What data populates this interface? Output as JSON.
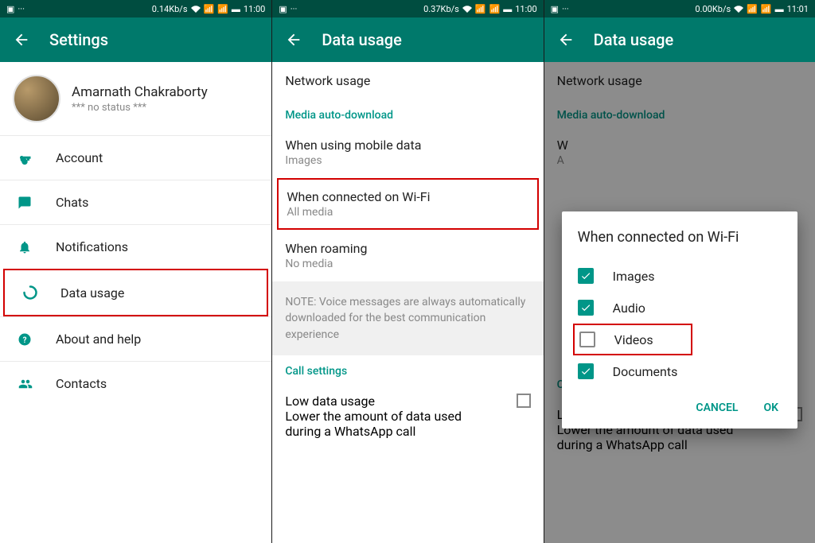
{
  "screen1": {
    "status": {
      "speed": "0.14Kb/s",
      "time": "11:00"
    },
    "title": "Settings",
    "profile": {
      "name": "Amarnath Chakraborty",
      "status": "*** no status ***"
    },
    "items": {
      "account": "Account",
      "chats": "Chats",
      "notifications": "Notifications",
      "data_usage": "Data usage",
      "about": "About and help",
      "contacts": "Contacts"
    }
  },
  "screen2": {
    "status": {
      "speed": "0.37Kb/s",
      "time": "11:00"
    },
    "title": "Data usage",
    "network_usage": "Network usage",
    "media_section": "Media auto-download",
    "mobile": {
      "primary": "When using mobile data",
      "secondary": "Images"
    },
    "wifi": {
      "primary": "When connected on Wi-Fi",
      "secondary": "All media"
    },
    "roaming": {
      "primary": "When roaming",
      "secondary": "No media"
    },
    "note": "NOTE: Voice messages are always automatically downloaded for the best communication experience",
    "call_section": "Call settings",
    "low_data": {
      "primary": "Low data usage",
      "secondary": "Lower the amount of data used during a WhatsApp call"
    }
  },
  "screen3": {
    "status": {
      "speed": "0.00Kb/s",
      "time": "11:01"
    },
    "title": "Data usage",
    "network_usage": "Network usage",
    "media_section": "Media auto-download",
    "wifi_primary": "W",
    "wifi_secondary": "A",
    "call_section": "Call settings",
    "low_data": {
      "primary": "Low data usage",
      "secondary": "Lower the amount of data used during a WhatsApp call"
    },
    "dialog": {
      "title": "When connected on Wi-Fi",
      "options": {
        "images": "Images",
        "audio": "Audio",
        "videos": "Videos",
        "documents": "Documents"
      },
      "cancel": "CANCEL",
      "ok": "OK"
    }
  }
}
